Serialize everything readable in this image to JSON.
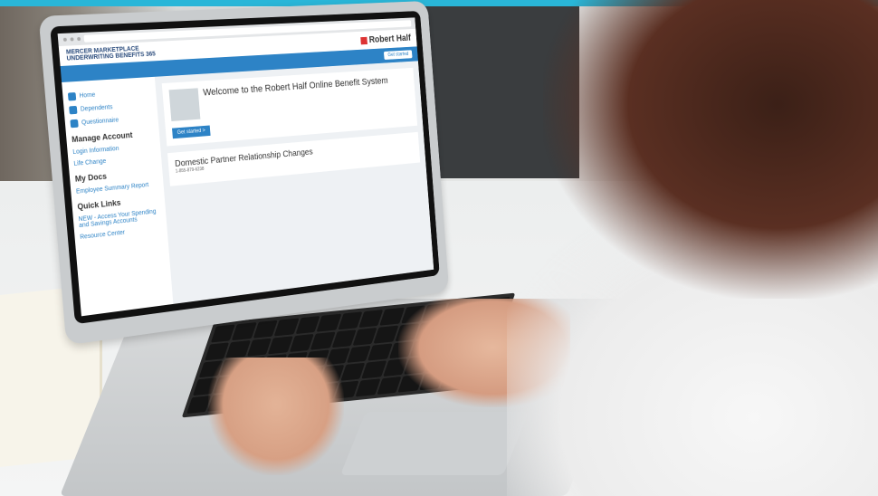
{
  "screen": {
    "brand": {
      "line1": "MERCER MARKETPLACE",
      "line2": "UNDERWRITING BENEFITS 365",
      "logo_text": "Robert Half"
    },
    "nav": {
      "button": "Get started"
    },
    "sidebar": {
      "items": [
        {
          "label": "Home",
          "icon": "home-icon"
        },
        {
          "label": "Dependents",
          "icon": "people-icon"
        },
        {
          "label": "Questionnaire",
          "icon": "questionnaire-icon"
        }
      ],
      "sections": [
        {
          "title": "Manage Account",
          "links": [
            "Login Information",
            "Life Change"
          ]
        },
        {
          "title": "My Docs",
          "links": [
            "Employee Summary Report"
          ]
        },
        {
          "title": "Quick Links",
          "links": [
            "NEW - Access Your Spending and Savings Accounts",
            "Resource Center"
          ]
        }
      ]
    },
    "welcome": {
      "title": "Welcome to the Robert Half Online Benefit System",
      "cta": "Get started >"
    },
    "domestic": {
      "title": "Domestic Partner Relationship Changes",
      "phone": "1-855-879-6238"
    }
  }
}
